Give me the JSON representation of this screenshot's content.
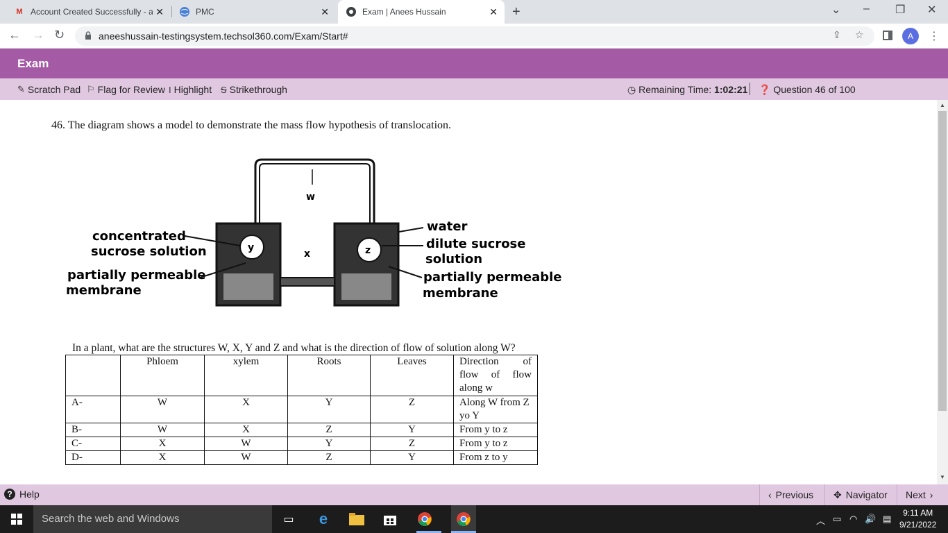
{
  "browser": {
    "tabs": [
      {
        "label": "Account Created Successfully - an",
        "favicon": "gmail-icon"
      },
      {
        "label": "PMC",
        "favicon": "globe-icon"
      },
      {
        "label": "Exam | Anees Hussain",
        "favicon": "site-icon"
      }
    ],
    "url": "aneeshussain-testingsystem.techsol360.com/Exam/Start#",
    "profile_initial": "A"
  },
  "exam": {
    "header_title": "Exam",
    "toolbar": {
      "scratch_pad": "Scratch Pad",
      "flag_for_review": "Flag for Review",
      "highlight": "Highlight",
      "strikethrough": "Strikethrough",
      "remaining_label": "Remaining Time:",
      "remaining_value": "1:02:21",
      "question_counter": "Question 46 of 100"
    },
    "question": {
      "title": "46.  The diagram shows a model to demonstrate the mass flow hypothesis of translocation.",
      "subquestion": "In a plant, what are the structures W, X, Y and Z and what is the direction of flow of solution along W?",
      "diagram": {
        "label_w": "w",
        "label_x": "x",
        "label_y": "y",
        "label_z": "z",
        "left_label_1a": "concentrated",
        "left_label_1b": "sucrose solution",
        "left_label_2a": "partially permeable",
        "left_label_2b": "membrane",
        "right_label_1": "water",
        "right_label_2a": "dilute sucrose",
        "right_label_2b": "solution",
        "right_label_3a": "partially permeable",
        "right_label_3b": "membrane"
      },
      "table": {
        "headers": [
          "",
          "Phloem",
          "xylem",
          "Roots",
          "Leaves",
          "Direction of flow of flow along w"
        ],
        "rows": [
          [
            "A-",
            "W",
            "X",
            "Y",
            "Z",
            "Along W from Z yo Y"
          ],
          [
            "B-",
            "W",
            "X",
            "Z",
            "Y",
            "From y to z"
          ],
          [
            "C-",
            "X",
            "W",
            "Y",
            "Z",
            "From y to z"
          ],
          [
            "D-",
            "X",
            "W",
            "Z",
            "Y",
            "From z to y"
          ]
        ]
      }
    },
    "footer": {
      "help": "Help",
      "previous": "Previous",
      "navigator": "Navigator",
      "next": "Next"
    }
  },
  "taskbar": {
    "search_placeholder": "Search the web and Windows",
    "time": "9:11 AM",
    "date": "9/21/2022"
  }
}
